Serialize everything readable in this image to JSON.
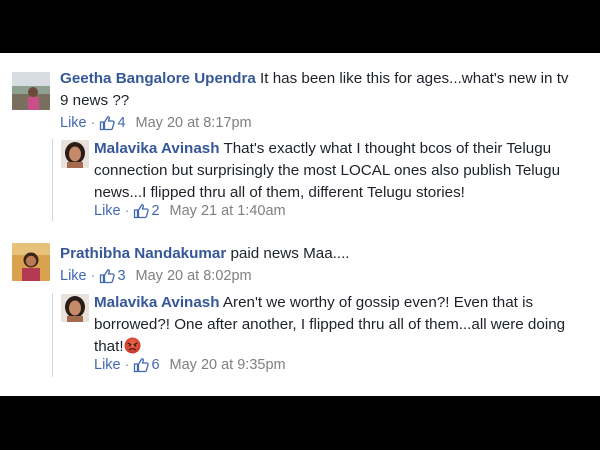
{
  "comments": [
    {
      "author": "Geetha Bangalore Upendra",
      "text": " It has been like this for ages...what's new in tv 9 news ??",
      "like_label": "Like",
      "reactions": "4",
      "time": "May 20 at 8:17pm",
      "reply": {
        "author": "Malavika Avinash",
        "text": " That's exactly what I thought bcos of their Telugu connection but surprisingly the most LOCAL ones also publish Telugu news...I flipped thru all of them, different Telugu stories!",
        "like_label": "Like",
        "reactions": "2",
        "time": "May 21 at 1:40am"
      }
    },
    {
      "author": "Prathibha Nandakumar",
      "text": " paid news Maa....",
      "like_label": "Like",
      "reactions": "3",
      "time": "May 20 at 8:02pm",
      "reply": {
        "author": "Malavika Avinash",
        "text": " Aren't we worthy of gossip even?! Even that is borrowed?! One after another, I flipped thru all of them...all were doing that!",
        "like_label": "Like",
        "reactions": "6",
        "time": "May 20 at 9:35pm"
      }
    }
  ],
  "colors": {
    "author": "#365899",
    "link": "#4267b2",
    "meta": "#7f7f7f",
    "text": "#1d2129"
  }
}
